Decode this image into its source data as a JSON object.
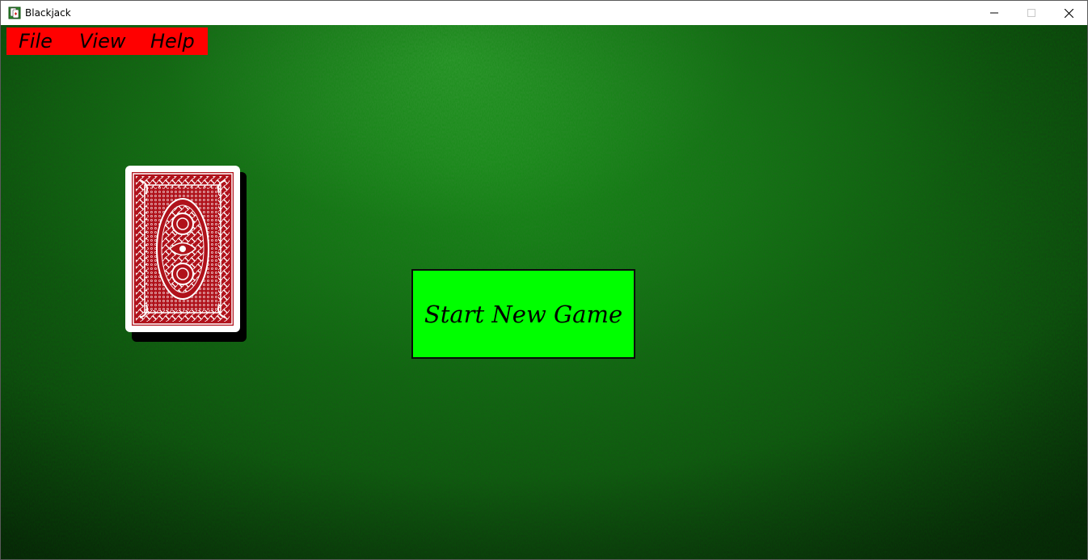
{
  "window": {
    "title": "Blackjack",
    "icon": "blackjack-cards-icon"
  },
  "menu": {
    "items": [
      {
        "label": "File"
      },
      {
        "label": "View"
      },
      {
        "label": "Help"
      }
    ],
    "background_color": "#ff0000"
  },
  "table": {
    "felt_color": "#1c7d1c"
  },
  "deck": {
    "icon": "card-back-icon",
    "back_color": "#b0121b"
  },
  "start_button": {
    "label": "Start New Game",
    "color": "#00ff00"
  }
}
